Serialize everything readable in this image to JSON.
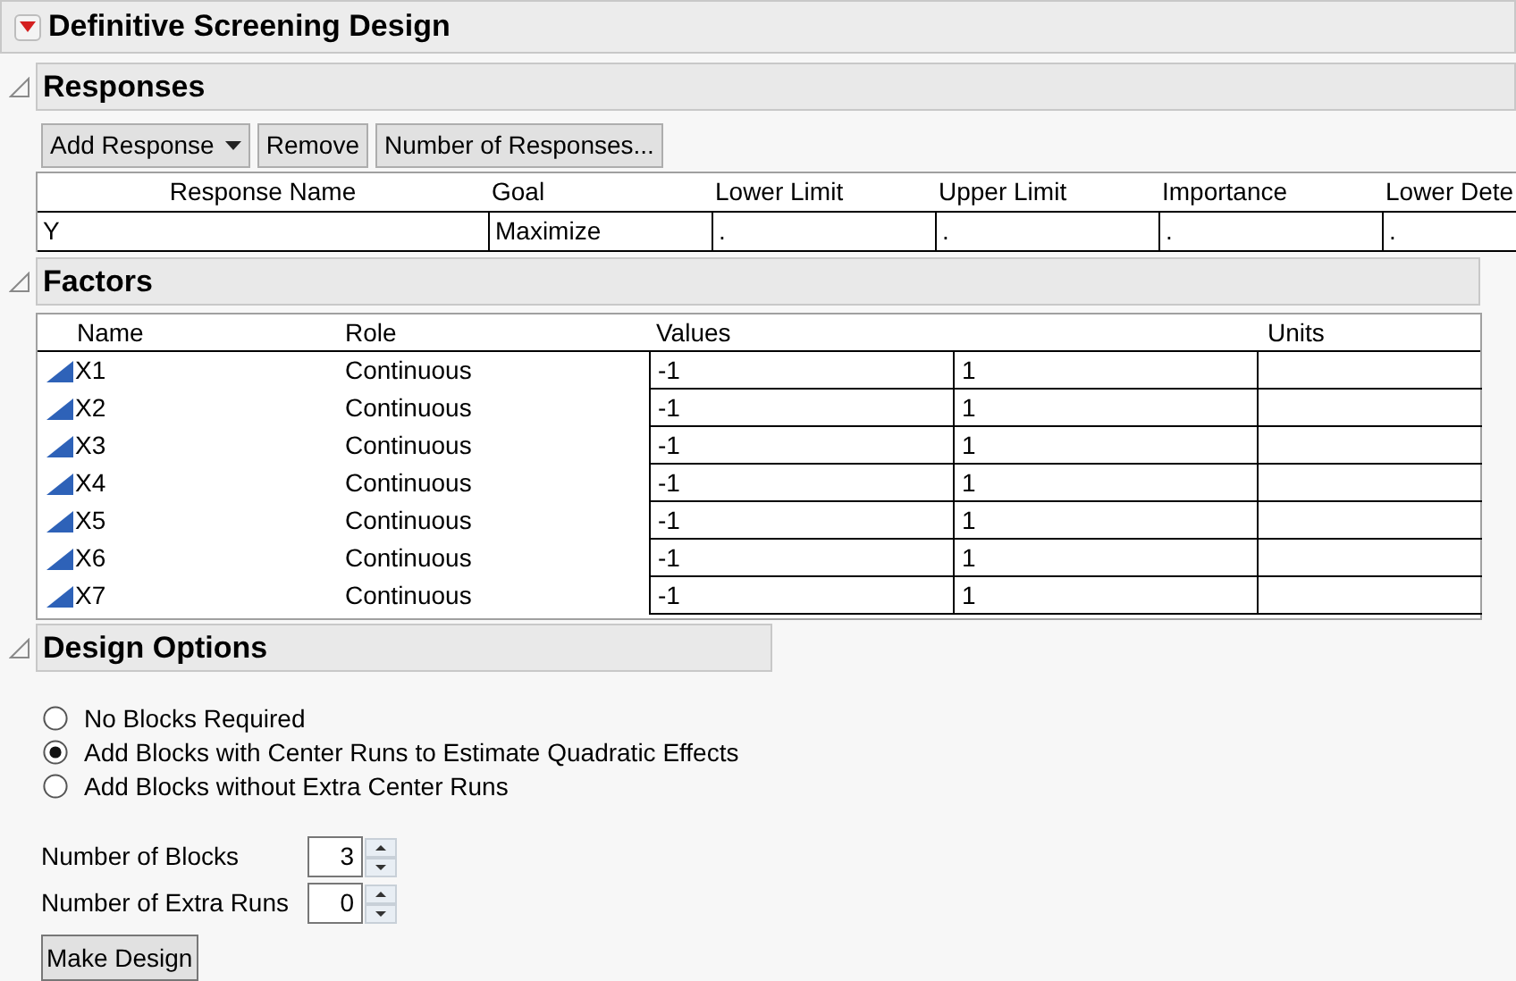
{
  "title": "Definitive Screening Design",
  "responses": {
    "header": "Responses",
    "expanded": true,
    "buttons": [
      {
        "label": "Add Response",
        "dropdown": true
      },
      {
        "label": "Remove",
        "dropdown": false
      },
      {
        "label": "Number of Responses...",
        "dropdown": false
      }
    ],
    "columns": [
      "Response Name",
      "Goal",
      "Lower Limit",
      "Upper Limit",
      "Importance",
      "Lower Dete"
    ],
    "rows": [
      [
        "Y",
        "Maximize",
        ".",
        ".",
        ".",
        "."
      ]
    ]
  },
  "factors": {
    "header": "Factors",
    "expanded": true,
    "columns": [
      "Name",
      "Role",
      "Values",
      "Units"
    ],
    "rows": [
      {
        "name": "X1",
        "role": "Continuous",
        "low": "-1",
        "high": "1"
      },
      {
        "name": "X2",
        "role": "Continuous",
        "low": "-1",
        "high": "1"
      },
      {
        "name": "X3",
        "role": "Continuous",
        "low": "-1",
        "high": "1"
      },
      {
        "name": "X4",
        "role": "Continuous",
        "low": "-1",
        "high": "1"
      },
      {
        "name": "X5",
        "role": "Continuous",
        "low": "-1",
        "high": "1"
      },
      {
        "name": "X6",
        "role": "Continuous",
        "low": "-1",
        "high": "1"
      },
      {
        "name": "X7",
        "role": "Continuous",
        "low": "-1",
        "high": "1"
      }
    ]
  },
  "design_options": {
    "header": "Design Options",
    "expanded": true,
    "radios": [
      {
        "label": "No Blocks Required",
        "selected": false
      },
      {
        "label": "Add Blocks with Center Runs to Estimate Quadratic Effects",
        "selected": true
      },
      {
        "label": "Add Blocks without Extra Center Runs",
        "selected": false
      }
    ],
    "spinners": [
      {
        "label": "Number of Blocks",
        "value": "3"
      },
      {
        "label": "Number of Extra Runs",
        "value": "0"
      }
    ],
    "button": "Make Design"
  }
}
